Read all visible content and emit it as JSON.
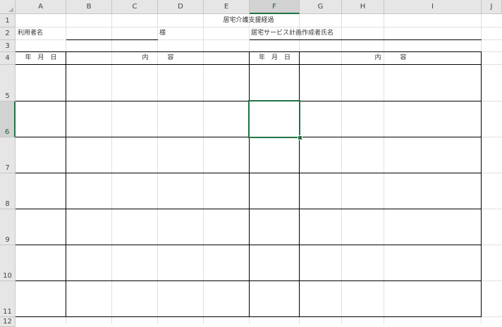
{
  "columns": [
    "A",
    "B",
    "C",
    "D",
    "E",
    "F",
    "G",
    "H",
    "I",
    "J"
  ],
  "rows": [
    "1",
    "2",
    "3",
    "4",
    "5",
    "6",
    "7",
    "8",
    "9",
    "10",
    "11",
    "12"
  ],
  "selected_column": "F",
  "selected_row": "6",
  "cells": {
    "title": "居宅介護支援経過",
    "user_name_label": "利用者名",
    "honorific": "様",
    "planner_name_label": "居宅サービス計画作成者氏名",
    "date_header_left": "年　月　日",
    "content_header_left": "内　　　容",
    "date_header_right": "年　月　日",
    "content_header_right": "内　　　容"
  },
  "colors": {
    "selection": "#217346",
    "header_bg": "#e6e6e6",
    "gridline": "#e0e0e0"
  }
}
